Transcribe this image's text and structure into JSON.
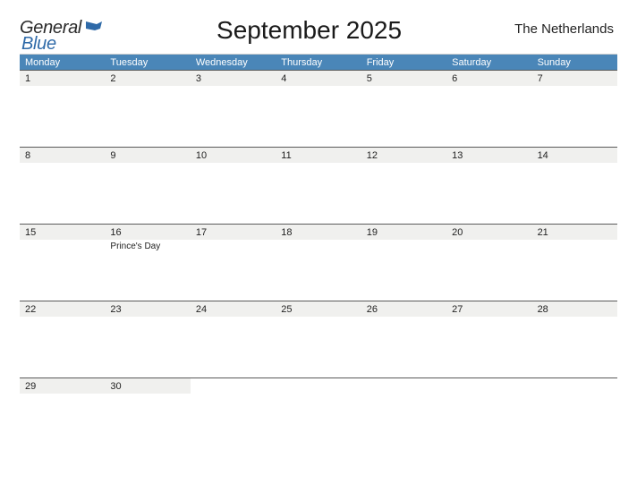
{
  "brand": {
    "part1": "General",
    "part2": "Blue"
  },
  "title": "September 2025",
  "region": "The Netherlands",
  "weekdays": [
    "Monday",
    "Tuesday",
    "Wednesday",
    "Thursday",
    "Friday",
    "Saturday",
    "Sunday"
  ],
  "weeks": [
    [
      {
        "n": "1"
      },
      {
        "n": "2"
      },
      {
        "n": "3"
      },
      {
        "n": "4"
      },
      {
        "n": "5"
      },
      {
        "n": "6"
      },
      {
        "n": "7"
      }
    ],
    [
      {
        "n": "8"
      },
      {
        "n": "9"
      },
      {
        "n": "10"
      },
      {
        "n": "11"
      },
      {
        "n": "12"
      },
      {
        "n": "13"
      },
      {
        "n": "14"
      }
    ],
    [
      {
        "n": "15"
      },
      {
        "n": "16",
        "note": "Prince's Day"
      },
      {
        "n": "17"
      },
      {
        "n": "18"
      },
      {
        "n": "19"
      },
      {
        "n": "20"
      },
      {
        "n": "21"
      }
    ],
    [
      {
        "n": "22"
      },
      {
        "n": "23"
      },
      {
        "n": "24"
      },
      {
        "n": "25"
      },
      {
        "n": "26"
      },
      {
        "n": "27"
      },
      {
        "n": "28"
      }
    ],
    [
      {
        "n": "29"
      },
      {
        "n": "30"
      },
      {
        "n": ""
      },
      {
        "n": ""
      },
      {
        "n": ""
      },
      {
        "n": ""
      },
      {
        "n": ""
      }
    ]
  ]
}
